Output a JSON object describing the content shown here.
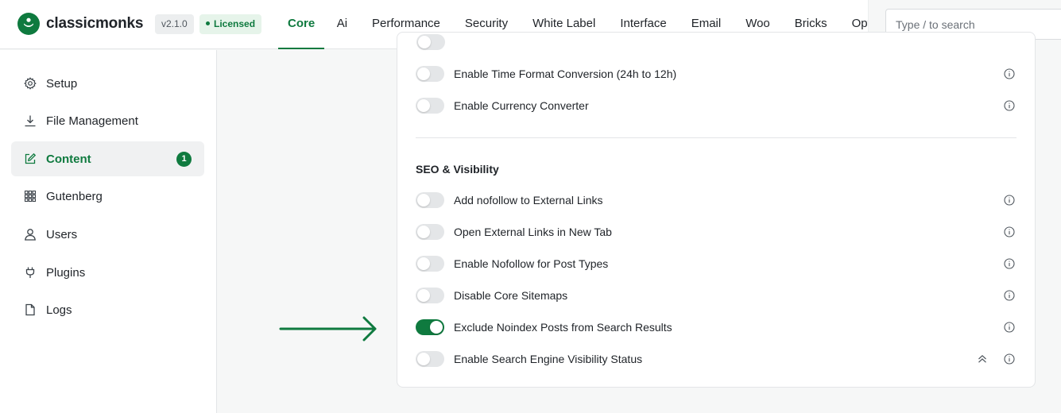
{
  "brand": {
    "name": "classicmonks",
    "version": "v2.1.0",
    "license": "Licensed"
  },
  "colors": {
    "accent": "#0f7a3f",
    "toggle_off": "#e4e6e8"
  },
  "tabs": [
    {
      "label": "Core",
      "active": true
    },
    {
      "label": "Ai"
    },
    {
      "label": "Performance"
    },
    {
      "label": "Security"
    },
    {
      "label": "White Label"
    },
    {
      "label": "Interface"
    },
    {
      "label": "Email"
    },
    {
      "label": "Woo"
    },
    {
      "label": "Bricks"
    },
    {
      "label": "Opt"
    }
  ],
  "search": {
    "placeholder": "Type / to search"
  },
  "sidebar": {
    "items": [
      {
        "label": "Setup",
        "icon": "gear-icon"
      },
      {
        "label": "File Management",
        "icon": "download-icon"
      },
      {
        "label": "Content",
        "icon": "edit-icon",
        "active": true,
        "badge": "1"
      },
      {
        "label": "Gutenberg",
        "icon": "grid-icon"
      },
      {
        "label": "Users",
        "icon": "user-icon"
      },
      {
        "label": "Plugins",
        "icon": "plug-icon"
      },
      {
        "label": "Logs",
        "icon": "file-icon"
      }
    ]
  },
  "settings": {
    "top_rows": [
      {
        "label": "Enable Time Format Conversion (24h to 12h)",
        "enabled": false
      },
      {
        "label": "Enable Currency Converter",
        "enabled": false
      }
    ],
    "seo_section": {
      "title": "SEO & Visibility",
      "rows": [
        {
          "label": "Add nofollow to External Links",
          "enabled": false
        },
        {
          "label": "Open External Links in New Tab",
          "enabled": false
        },
        {
          "label": "Enable Nofollow for Post Types",
          "enabled": false
        },
        {
          "label": "Disable Core Sitemaps",
          "enabled": false
        },
        {
          "label": "Exclude Noindex Posts from Search Results",
          "enabled": true
        },
        {
          "label": "Enable Search Engine Visibility Status",
          "enabled": false
        }
      ]
    }
  }
}
